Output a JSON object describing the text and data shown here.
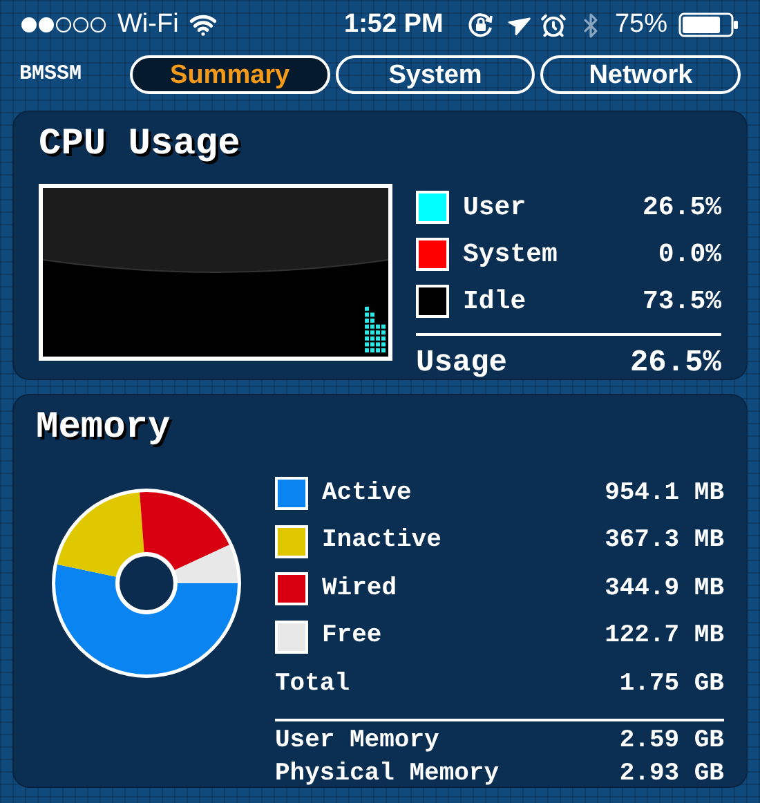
{
  "status_bar": {
    "carrier": "Wi-Fi",
    "time": "1:52 PM",
    "battery": "75%"
  },
  "app_title": "BMSSM",
  "tabs": [
    {
      "label": "Summary",
      "selected": true
    },
    {
      "label": "System",
      "selected": false
    },
    {
      "label": "Network",
      "selected": false
    }
  ],
  "cpu": {
    "title": "CPU Usage",
    "legend": [
      {
        "label": "User",
        "value": "26.5%",
        "color": "#00ffff"
      },
      {
        "label": "System",
        "value": "0.0%",
        "color": "#ff0000"
      },
      {
        "label": "Idle",
        "value": "73.5%",
        "color": "#000000"
      }
    ],
    "total": {
      "label": "Usage",
      "value": "26.5%"
    }
  },
  "memory": {
    "title": "Memory",
    "chart_data": {
      "type": "donut",
      "values": [
        53.3,
        20.5,
        19.3,
        6.9
      ]
    },
    "legend": [
      {
        "label": "Active",
        "value": "954.1 MB",
        "color": "#0a84f0"
      },
      {
        "label": "Inactive",
        "value": "367.3 MB",
        "color": "#e0c800"
      },
      {
        "label": "Wired",
        "value": "344.9 MB",
        "color": "#d80010"
      },
      {
        "label": "Free",
        "value": "122.7 MB",
        "color": "#e8e8e8"
      }
    ],
    "total": {
      "label": "Total",
      "value": "1.75 GB"
    },
    "extra": [
      {
        "label": "User Memory",
        "value": "2.59 GB"
      },
      {
        "label": "Physical Memory",
        "value": "2.93 GB"
      }
    ]
  }
}
